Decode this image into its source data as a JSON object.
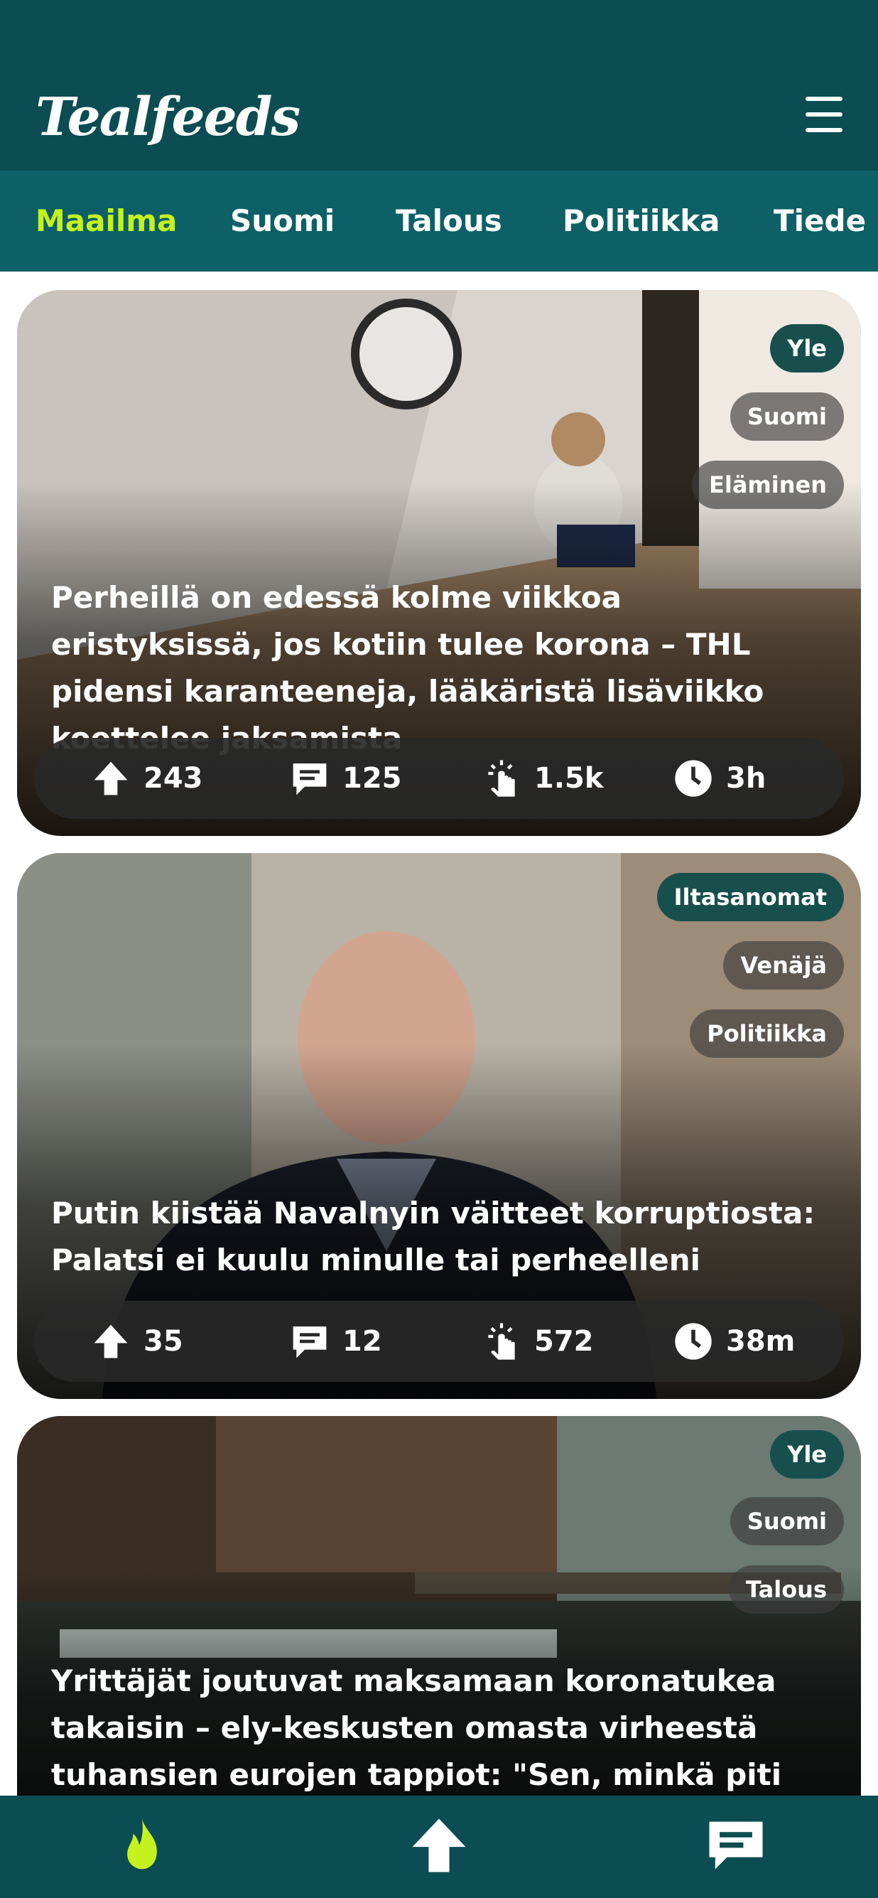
{
  "app": {
    "title": "Tealfeeds"
  },
  "colors": {
    "header": "#0b4d52",
    "tabbar": "#0d6166",
    "accent": "#c5f21d"
  },
  "tabs": [
    {
      "label": "Maailma",
      "active": true
    },
    {
      "label": "Suomi",
      "active": false
    },
    {
      "label": "Talous",
      "active": false
    },
    {
      "label": "Politiikka",
      "active": false
    },
    {
      "label": "Tiede",
      "active": false
    }
  ],
  "articles": [
    {
      "source": "Yle",
      "tags": [
        "Suomi",
        "Eläminen"
      ],
      "title": "Perheillä on edessä kolme viikkoa eristyksissä, jos kotiin tulee korona – THL pidensi karanteeneja, lääkäristä lisäviikko koettelee jaksamista",
      "upvotes": "243",
      "comments": "125",
      "clicks": "1.5k",
      "age": "3h"
    },
    {
      "source": "Iltasanomat",
      "tags": [
        "Venäjä",
        "Politiikka"
      ],
      "title": "Putin kiistää Navalnyin väitteet korruptiosta: Palatsi ei kuulu minulle tai perheelleni",
      "upvotes": "35",
      "comments": "12",
      "clicks": "572",
      "age": "38m"
    },
    {
      "source": "Yle",
      "tags": [
        "Suomi",
        "Talous"
      ],
      "title": "Yrittäjät joutuvat maksamaan koronatukea takaisin – ely-keskusten omasta virheestä tuhansien eurojen tappiot: \"Sen, minkä piti auttaa,"
    }
  ],
  "bottom_nav": [
    "fire-icon",
    "upvote-icon",
    "comments-icon"
  ]
}
